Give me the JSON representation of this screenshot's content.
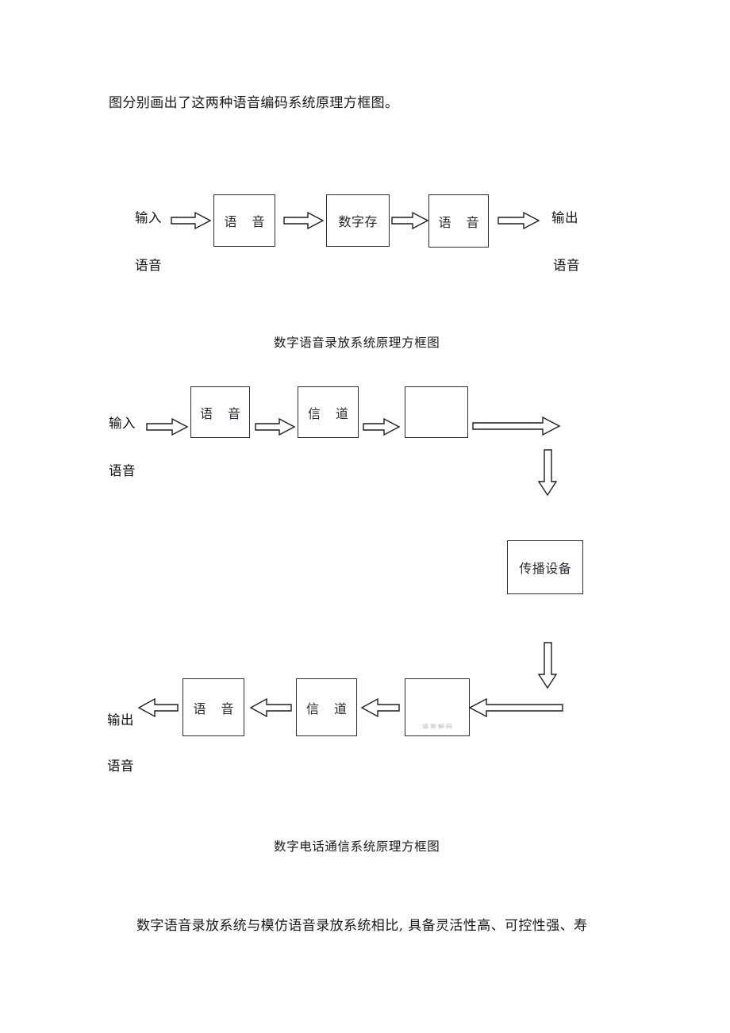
{
  "document": {
    "intro_paragraph": "图分别画出了这两种语音编码系统原理方框图。",
    "closing_paragraph": "数字语音录放系统与模仿语音录放系统相比, 具备灵活性高、可控性强、寿"
  },
  "figure1": {
    "caption": "数字语音录放系统原理方框图",
    "input_label": "输入",
    "input_label_2": "语音",
    "output_label": "输出",
    "output_label_2": "语音",
    "boxes": [
      {
        "text": "语 音"
      },
      {
        "text": "数字存"
      },
      {
        "text": "语 音"
      }
    ]
  },
  "figure2": {
    "caption": "数字电话通信系统原理方框图",
    "top_input_label": "输入",
    "top_input_label_2": "语音",
    "bottom_output_label": "输出",
    "bottom_output_label_2": "语音",
    "top_boxes": [
      {
        "text": "语 音"
      },
      {
        "text": "信 道"
      },
      {
        "text": ""
      }
    ],
    "middle_box": {
      "text": "传播设备"
    },
    "bottom_boxes": [
      {
        "text": "语 音"
      },
      {
        "text": "信 道"
      },
      {
        "text": "语音解码"
      }
    ]
  },
  "colors": {
    "page_background": "#ffffff",
    "text": "#1a1a1a",
    "box_border": "#2b2b33",
    "arrow_stroke": "#1d1d22",
    "arrow_fill": "#ffffff"
  }
}
